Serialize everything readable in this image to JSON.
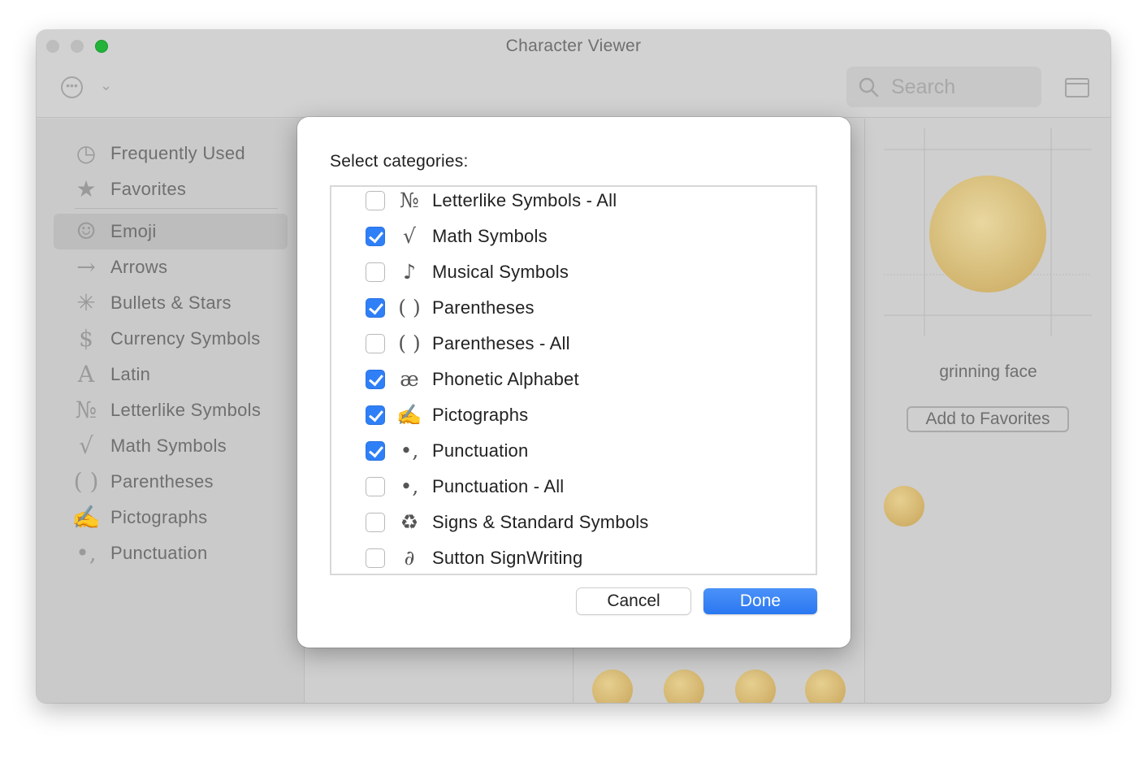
{
  "window": {
    "title": "Character Viewer"
  },
  "toolbar": {
    "search_placeholder": "Search"
  },
  "sidebar": {
    "items": [
      {
        "label": "Frequently Used",
        "icon": "clock-icon",
        "glyph": "◷"
      },
      {
        "label": "Favorites",
        "icon": "star-icon",
        "glyph": "★"
      },
      {
        "label": "Emoji",
        "icon": "emoji-icon",
        "glyph": "☺",
        "selected": true
      },
      {
        "label": "Arrows",
        "icon": "arrow-icon",
        "glyph": "→"
      },
      {
        "label": "Bullets & Stars",
        "icon": "asterisk-icon",
        "glyph": "✳"
      },
      {
        "label": "Currency Symbols",
        "icon": "dollar-icon",
        "glyph": "$"
      },
      {
        "label": "Latin",
        "icon": "latin-a-icon",
        "glyph": "A"
      },
      {
        "label": "Letterlike Symbols",
        "icon": "numero-icon",
        "glyph": "№"
      },
      {
        "label": "Math Symbols",
        "icon": "square-root-icon",
        "glyph": "√"
      },
      {
        "label": "Parentheses",
        "icon": "parentheses-icon",
        "glyph": "( )"
      },
      {
        "label": "Pictographs",
        "icon": "writing-hand-icon",
        "glyph": "✍"
      },
      {
        "label": "Punctuation",
        "icon": "punctuation-icon",
        "glyph": "•,"
      }
    ]
  },
  "preview": {
    "character_name": "grinning face",
    "add_favorites_label": "Add to Favorites"
  },
  "dialog": {
    "prompt": "Select categories:",
    "rows": [
      {
        "label": "Letterlike Symbols - All",
        "icon": "numero-icon",
        "glyph": "№",
        "checked": false
      },
      {
        "label": "Math Symbols",
        "icon": "square-root-icon",
        "glyph": "√",
        "checked": true
      },
      {
        "label": "Musical Symbols",
        "icon": "music-note-icon",
        "glyph": "♪",
        "checked": false
      },
      {
        "label": "Parentheses",
        "icon": "parentheses-icon",
        "glyph": "( )",
        "checked": true
      },
      {
        "label": "Parentheses - All",
        "icon": "parentheses-icon",
        "glyph": "( )",
        "checked": false
      },
      {
        "label": "Phonetic Alphabet",
        "icon": "ae-ligature-icon",
        "glyph": "æ",
        "checked": true
      },
      {
        "label": "Pictographs",
        "icon": "writing-hand-icon",
        "glyph": "✍",
        "checked": true
      },
      {
        "label": "Punctuation",
        "icon": "punctuation-icon",
        "glyph": "•,",
        "checked": true
      },
      {
        "label": "Punctuation - All",
        "icon": "punctuation-icon",
        "glyph": "•,",
        "checked": false
      },
      {
        "label": "Signs & Standard Symbols",
        "icon": "recycle-icon",
        "glyph": "♻",
        "checked": false
      },
      {
        "label": "Sutton SignWriting",
        "icon": "signwriting-icon",
        "glyph": "∂",
        "checked": false
      }
    ],
    "cancel_label": "Cancel",
    "done_label": "Done"
  },
  "colors": {
    "accent": "#2f7ff7",
    "close": "#bdbdbd",
    "maximize": "#22b33a"
  }
}
